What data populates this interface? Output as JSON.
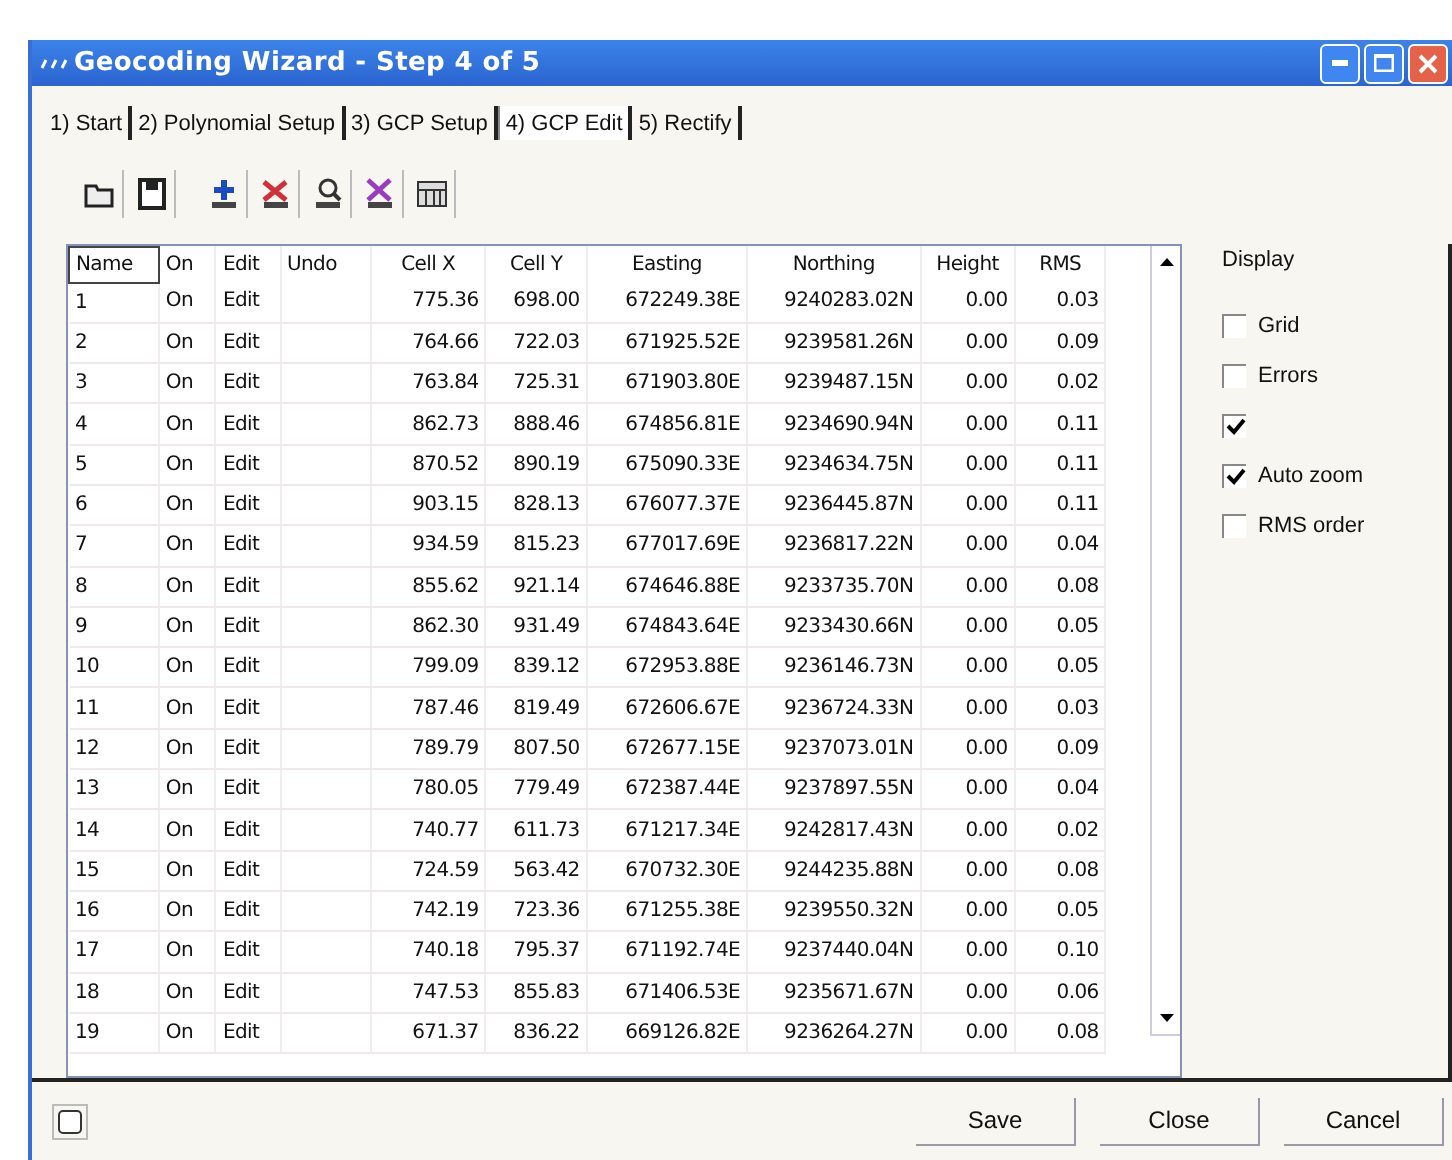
{
  "window": {
    "title": "Geocoding Wizard - Step 4 of 5"
  },
  "tabs": [
    {
      "label": "1) Start",
      "selected": false
    },
    {
      "label": "2) Polynomial Setup",
      "selected": false
    },
    {
      "label": "3) GCP Setup",
      "selected": false
    },
    {
      "label": "4) GCP Edit",
      "selected": true
    },
    {
      "label": "5) Rectify",
      "selected": false
    }
  ],
  "toolbar": [
    {
      "kind": "open"
    },
    {
      "kind": "save"
    },
    {
      "kind": "add"
    },
    {
      "kind": "delete"
    },
    {
      "kind": "find"
    },
    {
      "kind": "clear"
    },
    {
      "kind": "report"
    }
  ],
  "table": {
    "columns": [
      "Name",
      "On",
      "Edit",
      "Undo",
      "Cell X",
      "Cell Y",
      "Easting",
      "Northing",
      "Height",
      "RMS"
    ],
    "rows": [
      [
        "1",
        "On",
        "Edit",
        "",
        "775.36",
        "698.00",
        "672249.38E",
        "9240283.02N",
        "0.00",
        "0.03"
      ],
      [
        "2",
        "On",
        "Edit",
        "",
        "764.66",
        "722.03",
        "671925.52E",
        "9239581.26N",
        "0.00",
        "0.09"
      ],
      [
        "3",
        "On",
        "Edit",
        "",
        "763.84",
        "725.31",
        "671903.80E",
        "9239487.15N",
        "0.00",
        "0.02"
      ],
      [
        "4",
        "On",
        "Edit",
        "",
        "862.73",
        "888.46",
        "674856.81E",
        "9234690.94N",
        "0.00",
        "0.11"
      ],
      [
        "5",
        "On",
        "Edit",
        "",
        "870.52",
        "890.19",
        "675090.33E",
        "9234634.75N",
        "0.00",
        "0.11"
      ],
      [
        "6",
        "On",
        "Edit",
        "",
        "903.15",
        "828.13",
        "676077.37E",
        "9236445.87N",
        "0.00",
        "0.11"
      ],
      [
        "7",
        "On",
        "Edit",
        "",
        "934.59",
        "815.23",
        "677017.69E",
        "9236817.22N",
        "0.00",
        "0.04"
      ],
      [
        "8",
        "On",
        "Edit",
        "",
        "855.62",
        "921.14",
        "674646.88E",
        "9233735.70N",
        "0.00",
        "0.08"
      ],
      [
        "9",
        "On",
        "Edit",
        "",
        "862.30",
        "931.49",
        "674843.64E",
        "9233430.66N",
        "0.00",
        "0.05"
      ],
      [
        "10",
        "On",
        "Edit",
        "",
        "799.09",
        "839.12",
        "672953.88E",
        "9236146.73N",
        "0.00",
        "0.05"
      ],
      [
        "11",
        "On",
        "Edit",
        "",
        "787.46",
        "819.49",
        "672606.67E",
        "9236724.33N",
        "0.00",
        "0.03"
      ],
      [
        "12",
        "On",
        "Edit",
        "",
        "789.79",
        "807.50",
        "672677.15E",
        "9237073.01N",
        "0.00",
        "0.09"
      ],
      [
        "13",
        "On",
        "Edit",
        "",
        "780.05",
        "779.49",
        "672387.44E",
        "9237897.55N",
        "0.00",
        "0.04"
      ],
      [
        "14",
        "On",
        "Edit",
        "",
        "740.77",
        "611.73",
        "671217.34E",
        "9242817.43N",
        "0.00",
        "0.02"
      ],
      [
        "15",
        "On",
        "Edit",
        "",
        "724.59",
        "563.42",
        "670732.30E",
        "9244235.88N",
        "0.00",
        "0.08"
      ],
      [
        "16",
        "On",
        "Edit",
        "",
        "742.19",
        "723.36",
        "671255.38E",
        "9239550.32N",
        "0.00",
        "0.05"
      ],
      [
        "17",
        "On",
        "Edit",
        "",
        "740.18",
        "795.37",
        "671192.74E",
        "9237440.04N",
        "0.00",
        "0.10"
      ],
      [
        "18",
        "On",
        "Edit",
        "",
        "747.53",
        "855.83",
        "671406.53E",
        "9235671.67N",
        "0.00",
        "0.06"
      ],
      [
        "19",
        "On",
        "Edit",
        "",
        "671.37",
        "836.22",
        "669126.82E",
        "9236264.27N",
        "0.00",
        "0.08"
      ]
    ]
  },
  "display": {
    "title": "Display",
    "options": [
      {
        "label": "Grid",
        "checked": false
      },
      {
        "label": "Errors",
        "checked": false
      },
      {
        "checked": true
      },
      {
        "label": "Auto zoom",
        "checked": true
      },
      {
        "label": "RMS order",
        "checked": false
      }
    ]
  },
  "buttons": [
    "Save",
    "Close",
    "Cancel"
  ]
}
